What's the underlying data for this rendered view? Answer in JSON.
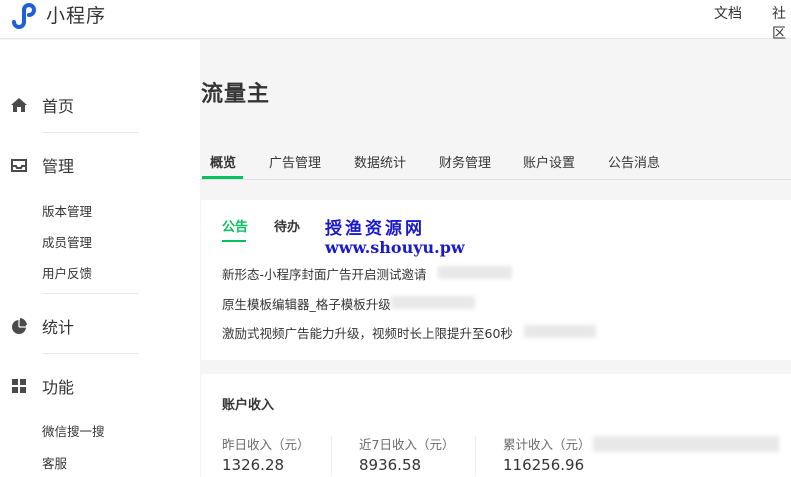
{
  "header": {
    "app_title": "小程序",
    "nav": [
      "文档",
      "社区"
    ]
  },
  "sidebar": {
    "groups": [
      {
        "icon": "home-icon",
        "label": "首页",
        "items": []
      },
      {
        "icon": "inbox-icon",
        "label": "管理",
        "items": [
          "版本管理",
          "成员管理",
          "用户反馈"
        ]
      },
      {
        "icon": "pie-chart-icon",
        "label": "统计",
        "items": []
      },
      {
        "icon": "grid-icon",
        "label": "功能",
        "items": [
          "微信搜一搜",
          "客服"
        ]
      }
    ]
  },
  "main": {
    "page_title": "流量主",
    "tabs": [
      "概览",
      "广告管理",
      "数据统计",
      "财务管理",
      "账户设置",
      "公告消息"
    ],
    "active_tab": 0,
    "notice_card": {
      "subtabs": [
        "公告",
        "待办"
      ],
      "active_subtab": 0,
      "watermark_line1": "授渔资源网",
      "watermark_line2": "www.shouyu.pw",
      "notices": [
        "新形态-小程序封面广告开启测试邀请",
        "原生模板编辑器_格子模板升级",
        "激励式视频广告能力升级，视频时长上限提升至60秒"
      ]
    },
    "income_card": {
      "title": "账户收入",
      "stats": [
        {
          "label": "昨日收入（元）",
          "value": "1326.28"
        },
        {
          "label": "近7日收入（元）",
          "value": "8936.58"
        },
        {
          "label": "累计收入（元）",
          "value": "116256.96"
        }
      ]
    }
  },
  "colors": {
    "accent": "#07c160",
    "logo": "#1e5fdc",
    "text": "#353535",
    "watermark": "#1a1acc"
  }
}
